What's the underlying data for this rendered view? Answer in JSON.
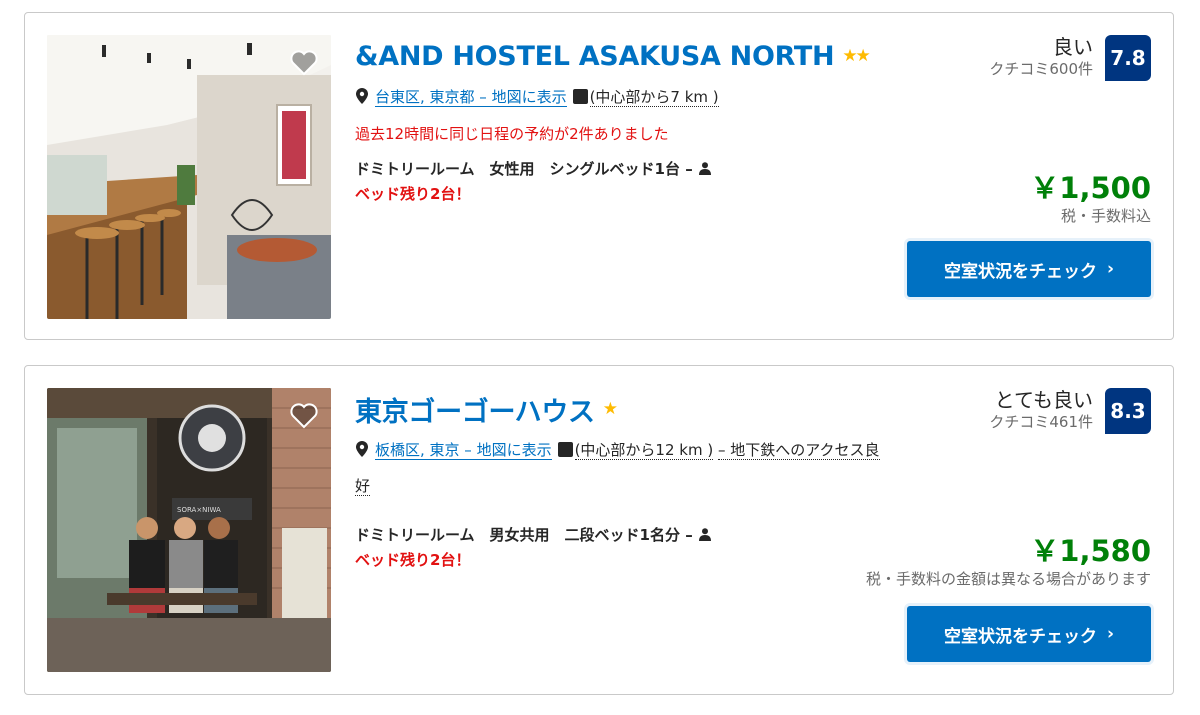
{
  "results": [
    {
      "name": "&AND HOSTEL ASAKUSA NORTH",
      "stars": "★★",
      "location_link": "台東区, 東京都 – 地図に表示",
      "distance": "(中心部から7 km )",
      "alert": "過去12時間に同じ日程の予約が2件ありました",
      "room": "ドミトリールーム　女性用　シングルベッド1台 –",
      "beds_left": "ベッド残り2台！",
      "rating_word": "良い",
      "review_count": "クチコミ600件",
      "score": "7.8",
      "price": "￥1,500",
      "tax_note": "税・手数料込",
      "cta": "空室状況をチェック",
      "image": "hostel-interior-photo"
    },
    {
      "name": "東京ゴーゴーハウス",
      "stars": "★",
      "location_link": "板橋区, 東京 – 地図に表示",
      "distance": "(中心部から12 km )",
      "extra": "– 地下鉄へのアクセス良",
      "extra_cont": "好",
      "room": "ドミトリールーム　男女共用　二段ベッド1名分 –",
      "beds_left": "ベッド残り2台！",
      "rating_word": "とても良い",
      "review_count": "クチコミ461件",
      "score": "8.3",
      "price": "￥1,580",
      "tax_note": "税・手数料の金額は異なる場合があります",
      "cta": "空室状況をチェック",
      "image": "guesthouse-storefront-photo"
    }
  ],
  "colors": {
    "link": "#0071c2",
    "score_bg": "#003580",
    "price": "#008009",
    "alert": "#e21111",
    "star": "#febb02"
  }
}
